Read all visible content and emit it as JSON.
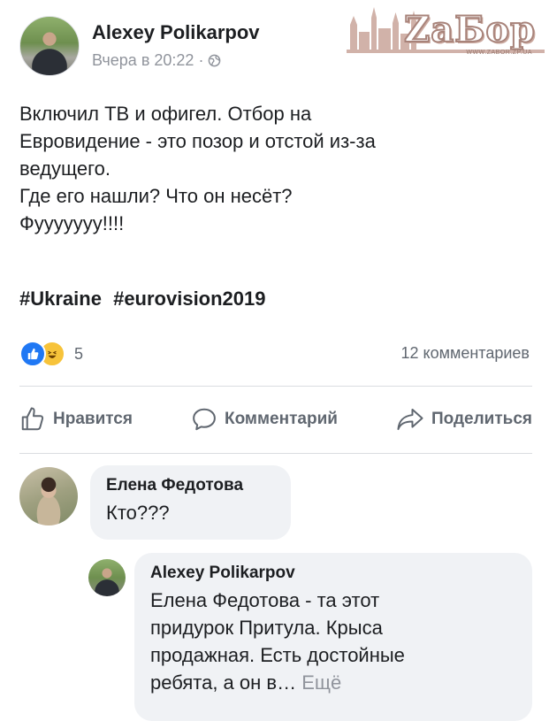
{
  "post": {
    "author": "Alexey Polikarpov",
    "time": "Вчера в 20:22",
    "separator": "·",
    "text_lines": [
      "Включил ТВ и офигел. Отбор на",
      "Евровидение - это позор и отстой из-за",
      "ведущего.",
      "Где его нашли? Что он несёт?",
      "Фууууууу!!!!"
    ],
    "hashtags": [
      "#Ukraine",
      "#eurovision2019"
    ]
  },
  "watermark": {
    "brand": "ZaБор",
    "url": "WWW.ZABOR.ZP.UA"
  },
  "reactions": {
    "count": "5",
    "icons": [
      "like-icon",
      "haha-icon"
    ],
    "comments": "12 комментариев"
  },
  "actions": {
    "like": "Нравится",
    "comment": "Комментарий",
    "share": "Поделиться"
  },
  "comments": [
    {
      "author": "Елена Федотова",
      "text": "Кто???"
    }
  ],
  "reply": {
    "author": "Alexey Polikarpov",
    "text_lines": [
      "Елена Федотова - та этот",
      "придурок Притула. Крыса",
      "продажная. Есть достойные",
      "ребята, а он в…"
    ],
    "more": "Ещё"
  },
  "colors": {
    "brand_blue": "#2078f4",
    "haha": "#f7c33a",
    "meta_gray": "#90949c",
    "bubble": "#f0f2f5"
  }
}
